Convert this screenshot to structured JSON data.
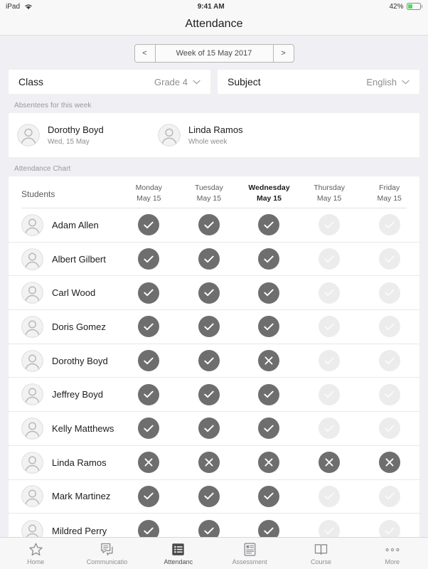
{
  "status_bar": {
    "device": "iPad",
    "wifi_icon": "wifi-icon",
    "time": "9:41 AM",
    "battery_percent": "42%",
    "battery_level": 42,
    "battery_color": "#4cd964"
  },
  "nav": {
    "title": "Attendance"
  },
  "week_nav": {
    "prev_label": "<",
    "week_label": "Week of 15 May 2017",
    "next_label": ">"
  },
  "selectors": [
    {
      "label": "Class",
      "value": "Grade 4",
      "chevron_icon": "chevron-down-icon"
    },
    {
      "label": "Subject",
      "value": "English",
      "chevron_icon": "chevron-down-icon"
    }
  ],
  "absentees": {
    "section_label": "Absentees for this week",
    "items": [
      {
        "name": "Dorothy Boyd",
        "detail": "Wed, 15 May",
        "avatar_icon": "avatar-icon"
      },
      {
        "name": "Linda Ramos",
        "detail": "Whole week",
        "avatar_icon": "avatar-icon"
      }
    ]
  },
  "attendance_chart": {
    "section_label": "Attendance Chart",
    "students_column_header": "Students",
    "days": [
      {
        "name": "Monday",
        "date": "May 15",
        "today": false
      },
      {
        "name": "Tuesday",
        "date": "May 15",
        "today": false
      },
      {
        "name": "Wednesday",
        "date": "May 15",
        "today": true
      },
      {
        "name": "Thursday",
        "date": "May 15",
        "today": false
      },
      {
        "name": "Friday",
        "date": "May 15",
        "today": false
      }
    ],
    "marks": {
      "present_icon": "check-icon",
      "absent_icon": "cross-icon",
      "present_color": "#6e6e6e",
      "future_color": "#ececec"
    },
    "rows": [
      {
        "name": "Adam Allen",
        "avatar_icon": "avatar-icon",
        "status": [
          "present",
          "present",
          "present",
          "future",
          "future"
        ]
      },
      {
        "name": "Albert Gilbert",
        "avatar_icon": "avatar-icon",
        "status": [
          "present",
          "present",
          "present",
          "future",
          "future"
        ]
      },
      {
        "name": "Carl Wood",
        "avatar_icon": "avatar-icon",
        "status": [
          "present",
          "present",
          "present",
          "future",
          "future"
        ]
      },
      {
        "name": "Doris Gomez",
        "avatar_icon": "avatar-icon",
        "status": [
          "present",
          "present",
          "present",
          "future",
          "future"
        ]
      },
      {
        "name": "Dorothy Boyd",
        "avatar_icon": "avatar-icon",
        "status": [
          "present",
          "present",
          "absent",
          "future",
          "future"
        ]
      },
      {
        "name": "Jeffrey Boyd",
        "avatar_icon": "avatar-icon",
        "status": [
          "present",
          "present",
          "present",
          "future",
          "future"
        ]
      },
      {
        "name": "Kelly Matthews",
        "avatar_icon": "avatar-icon",
        "status": [
          "present",
          "present",
          "present",
          "future",
          "future"
        ]
      },
      {
        "name": "Linda Ramos",
        "avatar_icon": "avatar-icon",
        "status": [
          "absent",
          "absent",
          "absent",
          "absent",
          "absent"
        ]
      },
      {
        "name": "Mark Martinez",
        "avatar_icon": "avatar-icon",
        "status": [
          "present",
          "present",
          "present",
          "future",
          "future"
        ]
      },
      {
        "name": "Mildred Perry",
        "avatar_icon": "avatar-icon",
        "status": [
          "present",
          "present",
          "present",
          "future",
          "future"
        ]
      }
    ]
  },
  "tab_bar": {
    "tabs": [
      {
        "label": "Home",
        "icon": "star-icon",
        "active": false
      },
      {
        "label": "Communicatio",
        "icon": "chat-icon",
        "active": false
      },
      {
        "label": "Attendanc",
        "icon": "list-icon",
        "active": true
      },
      {
        "label": "Assessment",
        "icon": "document-icon",
        "active": false
      },
      {
        "label": "Course",
        "icon": "book-icon",
        "active": false
      },
      {
        "label": "More",
        "icon": "ellipsis-icon",
        "active": false
      }
    ]
  }
}
